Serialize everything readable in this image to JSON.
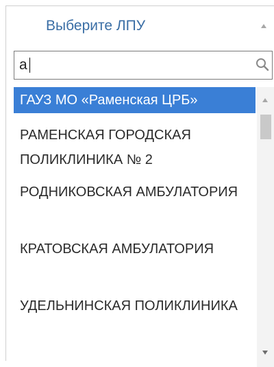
{
  "dropdown": {
    "title": "Выберите ЛПУ",
    "search_value": "а",
    "items": [
      "ГАУЗ МО «Раменская ЦРБ»",
      "РАМЕНСКАЯ ГОРОДСКАЯ ПОЛИКЛИНИКА № 2",
      "РОДНИКОВСКАЯ АМБУЛАТОРИЯ",
      "КРАТОВСКАЯ АМБУЛАТОРИЯ",
      "УДЕЛЬНИНСКАЯ ПОЛИКЛИНИКА"
    ],
    "selected_index": 0
  },
  "colors": {
    "selected_bg": "#3a7fd6",
    "title": "#3a6ea5"
  }
}
